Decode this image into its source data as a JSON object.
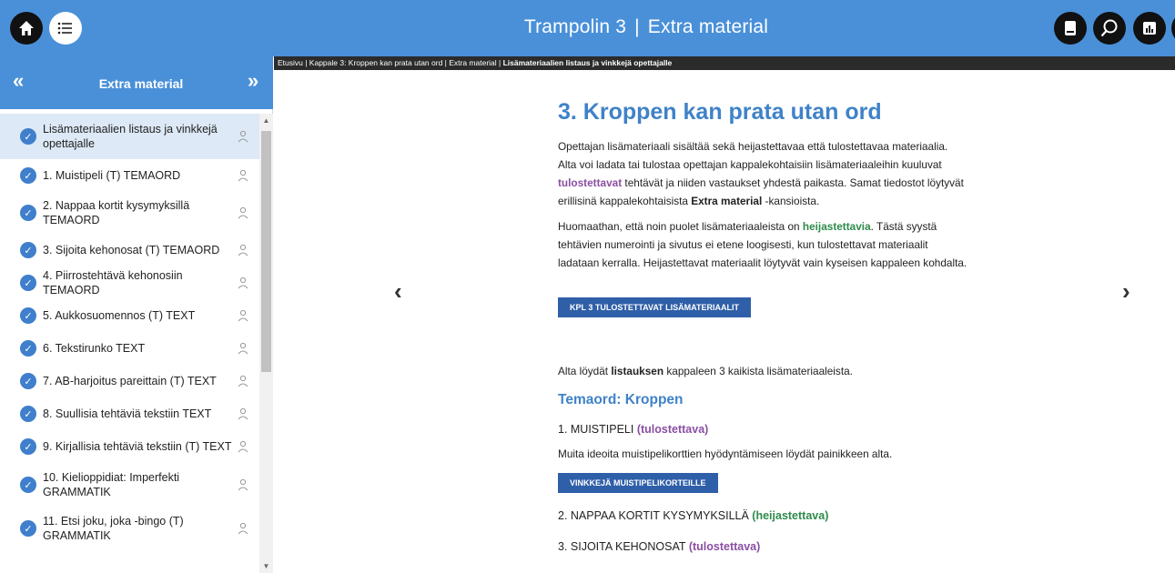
{
  "header": {
    "title": "Trampolin 3",
    "subtitle": "Extra material",
    "left_icons": [
      "home-icon",
      "menu-icon"
    ],
    "right_icons": [
      "book-icon",
      "search-icon",
      "stats-icon"
    ]
  },
  "sidebar": {
    "title": "Extra material",
    "collapse_label": "«",
    "expand_label": "»",
    "items": [
      {
        "label": "Lisämateriaalien listaus ja vinkkejä opettajalle",
        "active": true
      },
      {
        "label": "1. Muistipeli (T) TEMAORD"
      },
      {
        "label": "2. Nappaa kortit kysymyksillä TEMAORD"
      },
      {
        "label": "3. Sijoita kehonosat (T) TEMAORD"
      },
      {
        "label": "4. Piirrostehtävä kehonosiin TEMAORD"
      },
      {
        "label": "5. Aukkosuomennos (T) TEXT"
      },
      {
        "label": "6. Tekstirunko TEXT"
      },
      {
        "label": "7. AB-harjoitus pareittain (T) TEXT"
      },
      {
        "label": "8. Suullisia tehtäviä tekstiin TEXT"
      },
      {
        "label": "9. Kirjallisia tehtäviä tekstiin (T) TEXT"
      },
      {
        "label": "10. Kielioppidiat: Imperfekti GRAMMATIK"
      },
      {
        "label": "11. Etsi joku, joka -bingo (T) GRAMMATIK"
      }
    ]
  },
  "breadcrumb": {
    "path": "Etusivu | Kappale 3: Kroppen kan prata utan ord | Extra material | ",
    "current": "Lisämateriaalien listaus ja vinkkejä opettajalle"
  },
  "nav": {
    "prev": "‹",
    "next": "›"
  },
  "main": {
    "heading": "3. Kroppen kan prata utan ord",
    "p1a": "Opettajan lisämateriaali sisältää sekä heijastettavaa että tulostettavaa materiaalia. Alta voi ladata tai tulostaa opettajan kappalekohtaisiin lisämateriaaleihin kuuluvat ",
    "p1b": "tulostettavat",
    "p1c": " tehtävät ja niiden vastaukset yhdestä paikasta. Samat tiedostot löytyvät erillisinä kappalekohtaisista ",
    "p1d": "Extra material",
    "p1e": " -kansioista.",
    "p2a": "Huomaathan, että noin puolet lisämateriaaleista on ",
    "p2b": "heijastettavia",
    "p2c": ". Tästä syystä tehtävien numerointi ja sivutus ei etene loogisesti, kun tulostettavat materiaalit ladataan kerralla. Heijastettavat materiaalit löytyvät vain kyseisen kappaleen kohdalta.",
    "btn_print": "KPL 3 TULOSTETTAVAT LISÄMATERIAALIT",
    "p3a": "Alta löydät ",
    "p3b": "listauksen",
    "p3c": " kappaleen 3 kaikista lisämateriaaleista.",
    "section_heading": "Temaord: Kroppen",
    "s1": "1. MUISTIPELI",
    "s1tag": "(tulostettava)",
    "s1text": "Muita ideoita muistipelikorttien hyödyntämiseen löydät painikkeen alta.",
    "btn_tips": "VINKKEJÄ MUISTIPELIKORTEILLE",
    "s2": "2. NAPPAA KORTIT KYSYMYKSILLÄ",
    "s2tag": "(heijastettava)",
    "s3": "3. SIJOITA KEHONOSAT",
    "s3tag": "(tulostettava)"
  },
  "colors": {
    "brand": "#4a90d9",
    "accent": "#3f82c8",
    "button": "#2f5fa8",
    "purple": "#8a4fa3",
    "green": "#2e8b4a"
  }
}
